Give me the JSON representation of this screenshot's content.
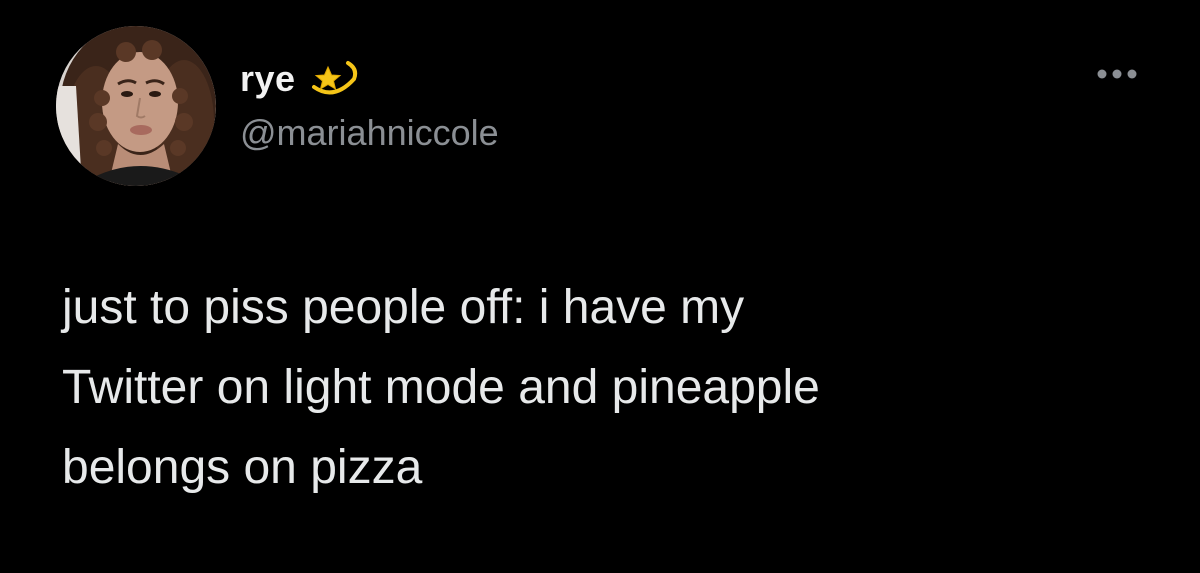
{
  "tweet": {
    "author": {
      "display_name": "rye",
      "handle": "@mariahniccole",
      "avatar_icon": "profile-photo",
      "name_emoji": "dizzy-star-icon"
    },
    "menu_icon": "more-horizontal-icon",
    "text_lines": [
      "just to piss people off: i have my",
      "Twitter on light mode and pineapple",
      "belongs on pizza"
    ]
  },
  "colors": {
    "background": "#000000",
    "primary_text": "#e7e9ea",
    "secondary_text": "#8b8f94",
    "star_gold": "#f5c518"
  }
}
